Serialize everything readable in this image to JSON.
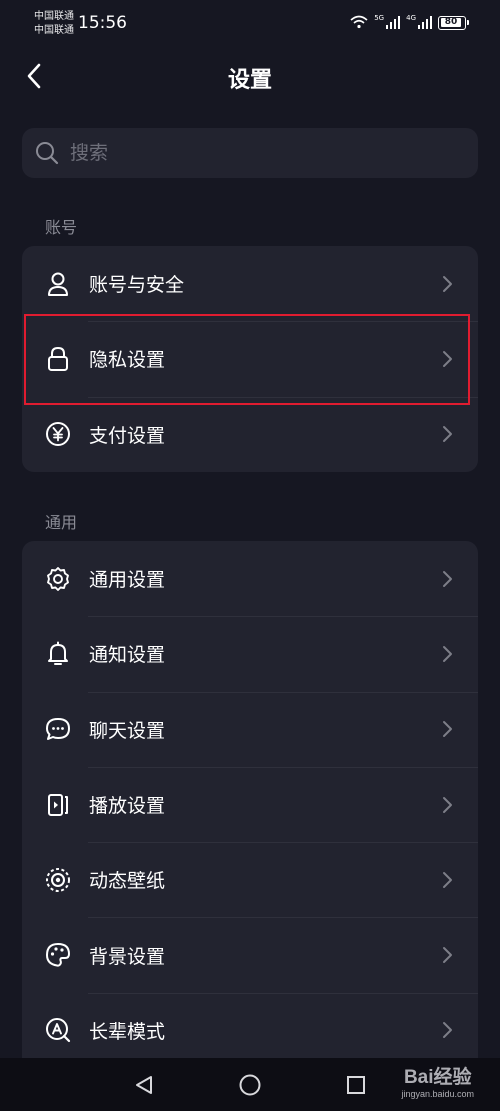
{
  "status_bar": {
    "carrier_1": "中国联通",
    "carrier_2": "中国联通",
    "time": "15:56",
    "net_1": "5G",
    "net_2": "4G",
    "battery": "80"
  },
  "header": {
    "title": "设置"
  },
  "search": {
    "placeholder": "搜索"
  },
  "sections": [
    {
      "title": "账号",
      "items": [
        {
          "label": "账号与安全",
          "icon": "user-icon"
        },
        {
          "label": "隐私设置",
          "icon": "lock-icon"
        },
        {
          "label": "支付设置",
          "icon": "yuan-icon"
        }
      ]
    },
    {
      "title": "通用",
      "items": [
        {
          "label": "通用设置",
          "icon": "gear-icon"
        },
        {
          "label": "通知设置",
          "icon": "bell-icon"
        },
        {
          "label": "聊天设置",
          "icon": "chat-icon"
        },
        {
          "label": "播放设置",
          "icon": "play-icon"
        },
        {
          "label": "动态壁纸",
          "icon": "wallpaper-icon"
        },
        {
          "label": "背景设置",
          "icon": "palette-icon"
        },
        {
          "label": "长辈模式",
          "icon": "elder-mode-icon"
        }
      ]
    }
  ],
  "colors": {
    "background": "#161722",
    "card": "#22232f",
    "highlight": "#e01c30"
  },
  "watermark": {
    "main": "Bai经验",
    "sub": "jingyan.baidu.com"
  }
}
